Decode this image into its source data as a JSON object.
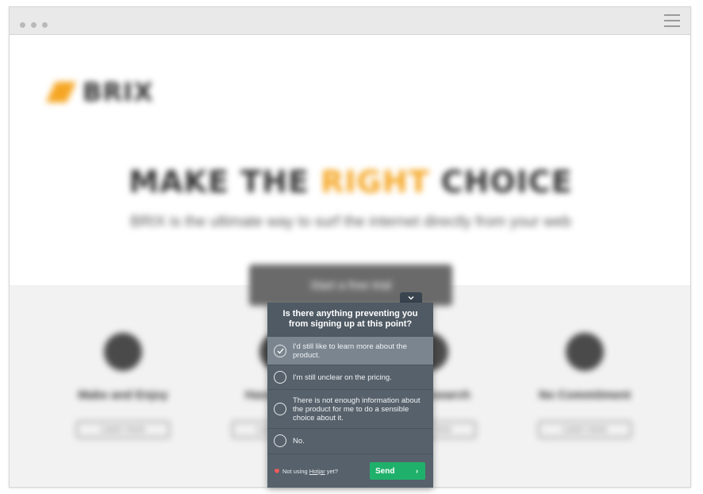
{
  "colors": {
    "accent": "#f5a623",
    "widget_bg": "#56616b",
    "widget_selected": "#7a858f",
    "send_button": "#1fb16b"
  },
  "background_page": {
    "logo": {
      "text": "BRIX",
      "icon": "logo-slash-icon"
    },
    "headline": {
      "part1": "MAKE THE ",
      "accent": "RIGHT",
      "part2": " CHOICE"
    },
    "subline": "BRIX is the ultimate way to surf the internet directly from your web",
    "cta_label": "Start a free trial",
    "features": [
      {
        "title": "Make and Enjoy",
        "button": "Learn more",
        "icon": "circle-icon"
      },
      {
        "title": "Hassle Free",
        "button": "Learn more",
        "icon": "circle-icon"
      },
      {
        "title": "Free Research",
        "button": "Learn more",
        "icon": "circle-icon"
      },
      {
        "title": "No Commitment",
        "button": "Learn more",
        "icon": "trophy-icon"
      }
    ]
  },
  "survey": {
    "question": "Is there anything preventing you from signing up at this point?",
    "options": [
      {
        "label": "I'd still like to learn more about the product.",
        "selected": true
      },
      {
        "label": "I'm still unclear on the pricing.",
        "selected": false
      },
      {
        "label": "There is not enough information about the product for me to do a sensible choice about it.",
        "selected": false
      },
      {
        "label": "No.",
        "selected": false
      }
    ],
    "footer": {
      "prefix": "Not using",
      "link": "Hotjar",
      "suffix": "yet?"
    },
    "send_label": "Send"
  }
}
